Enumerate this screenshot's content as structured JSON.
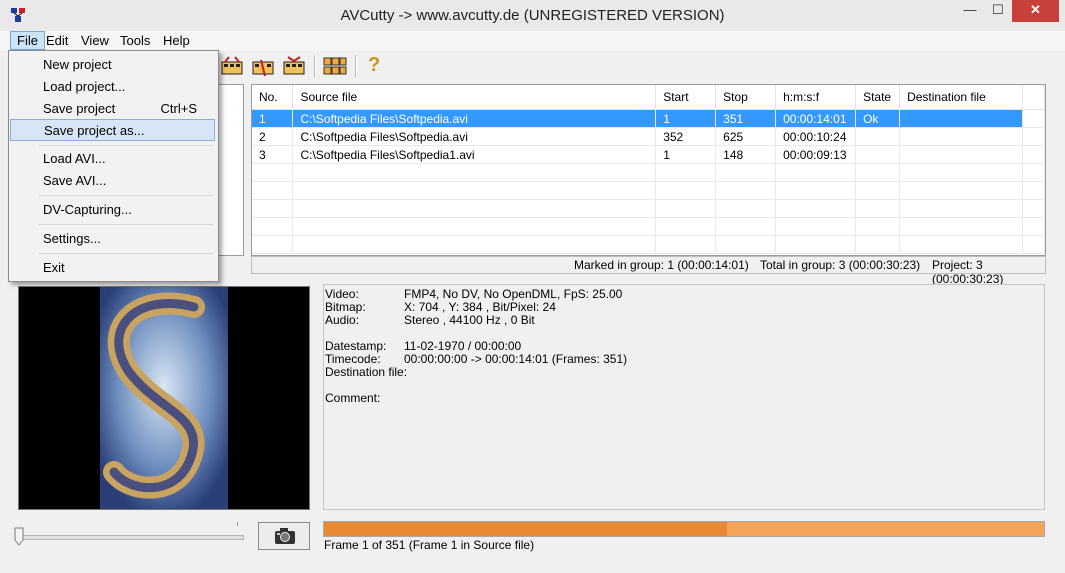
{
  "window": {
    "title": "AVCutty -> www.avcutty.de (UNREGISTERED VERSION)",
    "minimize": "—",
    "maximize": "☐",
    "close": "✕"
  },
  "menubar": [
    "File",
    "Edit",
    "View",
    "Tools",
    "Help"
  ],
  "file_menu": {
    "items": [
      {
        "label": "New project",
        "shortcut": ""
      },
      {
        "label": "Load project...",
        "shortcut": ""
      },
      {
        "label": "Save project",
        "shortcut": "Ctrl+S"
      },
      {
        "label": "Save project as...",
        "shortcut": ""
      },
      {
        "label": "Load AVI...",
        "shortcut": ""
      },
      {
        "label": "Save AVI...",
        "shortcut": ""
      },
      {
        "label": "DV-Capturing...",
        "shortcut": ""
      },
      {
        "label": "Settings...",
        "shortcut": ""
      },
      {
        "label": "Exit",
        "shortcut": ""
      }
    ]
  },
  "toolbar": {
    "help": "?"
  },
  "table": {
    "headers": [
      "No.",
      "Source file",
      "Start",
      "Stop",
      "h:m:s:f",
      "State",
      "Destination file"
    ],
    "rows": [
      [
        "1",
        "C:\\Softpedia Files\\Softpedia.avi",
        "1",
        "351",
        "00:00:14:01",
        "Ok",
        ""
      ],
      [
        "2",
        "C:\\Softpedia Files\\Softpedia.avi",
        "352",
        "625",
        "00:00:10:24",
        "",
        ""
      ],
      [
        "3",
        "C:\\Softpedia Files\\Softpedia1.avi",
        "1",
        "148",
        "00:00:09:13",
        "",
        ""
      ]
    ]
  },
  "status": {
    "marked": "Marked in group: 1 (00:00:14:01)",
    "total": "Total in group: 3 (00:00:30:23)",
    "project": "Project: 3 (00:00:30:23)"
  },
  "info": {
    "video_label": "Video:",
    "video": "FMP4, No DV, No OpenDML, FpS: 25.00",
    "bitmap_label": "Bitmap:",
    "bitmap": "X: 704 , Y: 384 , Bit/Pixel: 24",
    "audio_label": "Audio:",
    "audio": "Stereo , 44100 Hz , 0 Bit",
    "datestamp_label": "Datestamp:",
    "datestamp": "11-02-1970 / 00:00:00",
    "timecode_label": "Timecode:",
    "timecode": "00:00:00:00 -> 00:00:14:01 (Frames: 351)",
    "destination_label": "Destination file:",
    "comment_label": "Comment:"
  },
  "progress": {
    "fraction": 0.56
  },
  "frame_text": "Frame 1 of 351 (Frame 1 in Source file)",
  "colors": {
    "selection": "#3399ff",
    "progress": "#e98a32",
    "close": "#c7403a"
  }
}
